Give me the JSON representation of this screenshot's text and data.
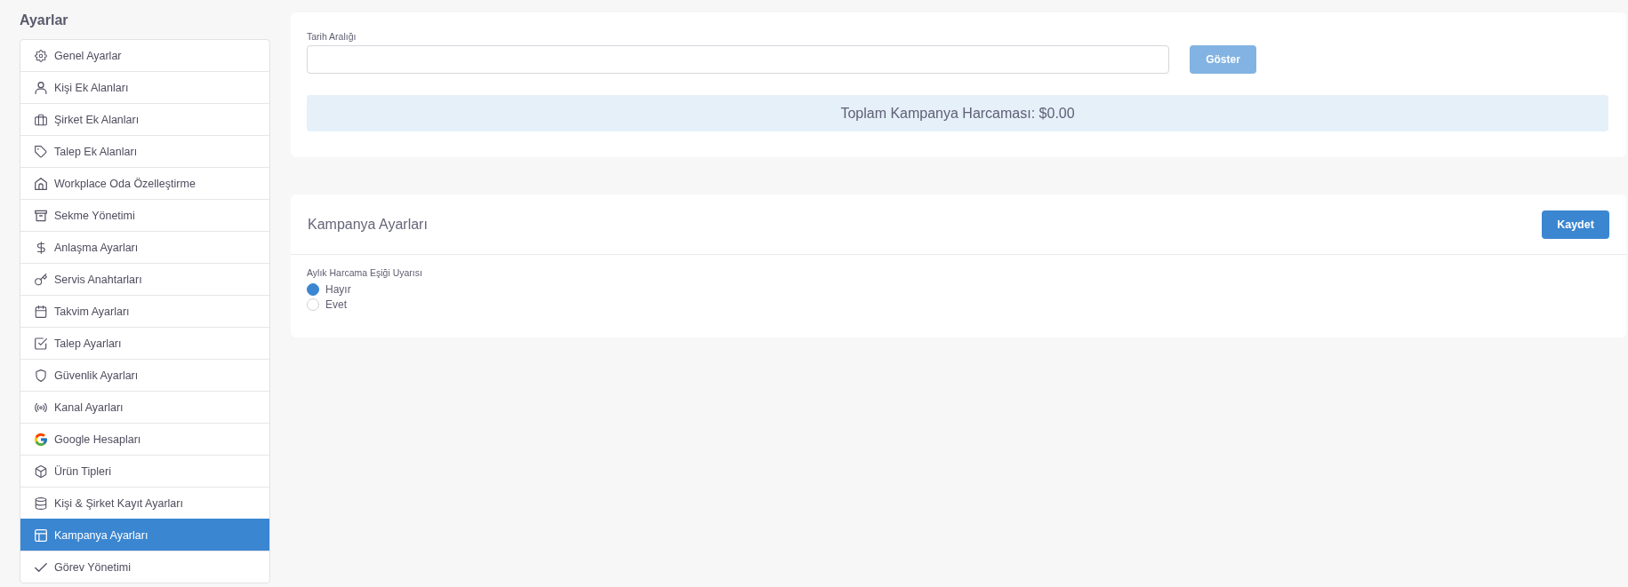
{
  "sidebar": {
    "title": "Ayarlar",
    "items": [
      {
        "label": "Genel Ayarlar",
        "selected": false
      },
      {
        "label": "Kişi Ek Alanları",
        "selected": false
      },
      {
        "label": "Şirket Ek Alanları",
        "selected": false
      },
      {
        "label": "Talep Ek Alanları",
        "selected": false
      },
      {
        "label": "Workplace Oda Özelleştirme",
        "selected": false
      },
      {
        "label": "Sekme Yönetimi",
        "selected": false
      },
      {
        "label": "Anlaşma Ayarları",
        "selected": false
      },
      {
        "label": "Servis Anahtarları",
        "selected": false
      },
      {
        "label": "Takvim Ayarları",
        "selected": false
      },
      {
        "label": "Talep Ayarları",
        "selected": false
      },
      {
        "label": "Güvenlik Ayarları",
        "selected": false
      },
      {
        "label": "Kanal Ayarları",
        "selected": false
      },
      {
        "label": "Google Hesapları",
        "selected": false
      },
      {
        "label": "Ürün Tipleri",
        "selected": false
      },
      {
        "label": "Kişi & Şirket Kayıt Ayarları",
        "selected": false
      },
      {
        "label": "Kampanya Ayarları",
        "selected": true
      },
      {
        "label": "Görev Yönetimi",
        "selected": false
      }
    ]
  },
  "spend_filter": {
    "field_label": "Tarih Aralığı",
    "button": {
      "label": "Göster",
      "disabled": true
    },
    "total": "Toplam Kampanya Harcaması: $0.00"
  },
  "campaign_settings": {
    "title": "Kampanya Ayarları",
    "save_button": "Kaydet",
    "fields": [
      {
        "label": "Aylık Harcama Eşiği Uyarısı",
        "options": [
          {
            "label": "Hayır",
            "selected": true
          },
          {
            "label": "Evet",
            "selected": false
          }
        ]
      }
    ]
  }
}
